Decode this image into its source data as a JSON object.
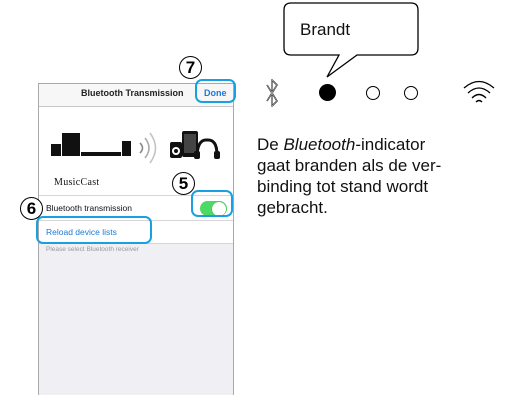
{
  "phone": {
    "nav_title": "Bluetooth Transmission",
    "done_label": "Done",
    "brand": "MusicCast",
    "bt_transmission_label": "Bluetooth transmission",
    "bt_transmission_on": true,
    "reload_label": "Reload device lists",
    "hint": "Please select Bluetooth receiver"
  },
  "steps": {
    "done": "7",
    "toggle": "5",
    "reload": "6"
  },
  "device": {
    "callout": "Brandt",
    "icons": [
      "bluetooth-icon",
      "status-led-on",
      "status-led-off",
      "status-led-off",
      "wifi-icon"
    ]
  },
  "description": {
    "line1_pre": "De ",
    "line1_italic": "Bluetooth",
    "line1_post": "-indicator",
    "line2": "gaat branden als de ver-",
    "line3": "binding tot stand wordt",
    "line4": "gebracht."
  },
  "colors": {
    "accent_blue": "#1a7ad8",
    "highlight": "#1aa0e0",
    "toggle_on": "#4cd964"
  }
}
